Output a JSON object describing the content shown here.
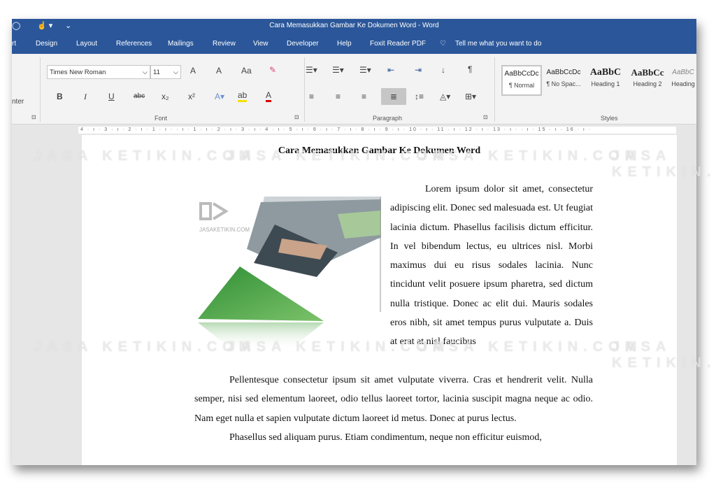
{
  "window": {
    "title": "Cara Memasukkan Gambar Ke Dokumen Word  -  Word"
  },
  "tabs": [
    "rt",
    "Design",
    "Layout",
    "References",
    "Mailings",
    "Review",
    "View",
    "Developer",
    "Help",
    "Foxit Reader PDF"
  ],
  "tell_me": "Tell me what you want to do",
  "ribbon": {
    "clipboard_partial": "nter",
    "font": {
      "name": "Times New Roman",
      "size": "11",
      "group_label": "Font",
      "bold": "B",
      "italic": "I",
      "underline": "U",
      "strike": "abc",
      "sub": "x₂",
      "sup": "x²",
      "grow": "A",
      "shrink": "A",
      "case": "Aa"
    },
    "paragraph": {
      "group_label": "Paragraph",
      "pilcrow": "¶"
    },
    "styles": {
      "group_label": "Styles",
      "items": [
        {
          "preview": "AaBbCcDc",
          "name": "¶ Normal"
        },
        {
          "preview": "AaBbCcDc",
          "name": "¶ No Spac..."
        },
        {
          "preview": "AaBbC",
          "name": "Heading 1"
        },
        {
          "preview": "AaBbCc",
          "name": "Heading 2"
        },
        {
          "preview": "AaBbC",
          "name": "Heading"
        }
      ]
    }
  },
  "ruler": "4 · ı · 3 · ı · 2 · ı · 1 · ı ·      · ı · 1 · ı · 2 · ı · 3 · ı · 4 · ı · 5 · ı · 6 · ı · 7 · ı · 8 · ı · 9 · ı · 10 · ı · 11 · ı · 12 · ı · 13 · ı ·   · ı · 15 · ı · 16 · ı ·",
  "document": {
    "title": "Cara Memasukkan Gambar Ke Dokumen Word",
    "wrap_paragraph": "Lorem ipsum dolor sit amet, consectetur adipiscing elit. Donec sed malesuada est. Ut feugiat lacinia dictum. Phasellus facilisis dictum efficitur. In vel bibendum lectus, eu ultrices nisl. Morbi maximus dui eu risus sodales lacinia. Nunc tincidunt velit posuere ipsum pharetra, sed dictum nulla tristique. Donec ac elit dui. Mauris sodales eros nibh, sit amet tempus purus vulputate a. Duis at erat at nisl faucibus",
    "paragraph2": "Pellentesque consectetur ipsum sit amet vulputate viverra. Cras et hendrerit velit. Nulla semper, nisi sed elementum laoreet, odio tellus laoreet tortor, lacinia suscipit magna neque ac odio. Nam eget nulla et sapien vulputate dictum laoreet id metus. Donec at purus lectus.",
    "paragraph3": "Phasellus sed aliquam purus. Etiam condimentum, neque non efficitur euismod,"
  },
  "watermark": "JASA KETIKIN.COM",
  "image_logo": "JASAKETIKIN.COM",
  "colors": {
    "accent": "#2b579a",
    "green": "#3c9a3c"
  }
}
